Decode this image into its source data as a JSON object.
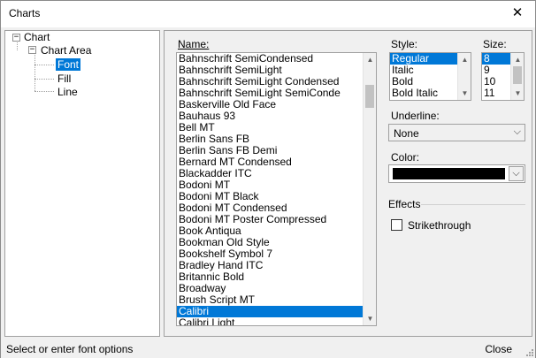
{
  "window": {
    "title": "Charts"
  },
  "tree": {
    "items": [
      {
        "label": "Chart"
      },
      {
        "label": "Chart Area"
      },
      {
        "label": "Font"
      },
      {
        "label": "Fill"
      },
      {
        "label": "Line"
      }
    ]
  },
  "font_panel": {
    "name_label": "Name:",
    "font_names": [
      "Bahnschrift SemiCondensed",
      "Bahnschrift SemiLight",
      "Bahnschrift SemiLight Condensed",
      "Bahnschrift SemiLight SemiConde",
      "Baskerville Old Face",
      "Bauhaus 93",
      "Bell MT",
      "Berlin Sans FB",
      "Berlin Sans FB Demi",
      "Bernard MT Condensed",
      "Blackadder ITC",
      "Bodoni MT",
      "Bodoni MT Black",
      "Bodoni MT Condensed",
      "Bodoni MT Poster Compressed",
      "Book Antiqua",
      "Bookman Old Style",
      "Bookshelf Symbol 7",
      "Bradley Hand ITC",
      "Britannic Bold",
      "Broadway",
      "Brush Script MT",
      "Calibri",
      "Calibri Light"
    ],
    "selected_font": "Calibri",
    "style_label": "Style:",
    "styles": [
      "Regular",
      "Italic",
      "Bold",
      "Bold Italic"
    ],
    "selected_style": "Regular",
    "size_label": "Size:",
    "sizes": [
      "8",
      "9",
      "10",
      "11"
    ],
    "selected_size": "8",
    "underline_label": "Underline:",
    "underline_value": "None",
    "color_label": "Color:",
    "color_value": "#000000",
    "effects_label": "Effects",
    "strikethrough_label": "Strikethrough",
    "strikethrough_checked": false
  },
  "status": {
    "text": "Select or enter font options",
    "close_label": "Close"
  }
}
